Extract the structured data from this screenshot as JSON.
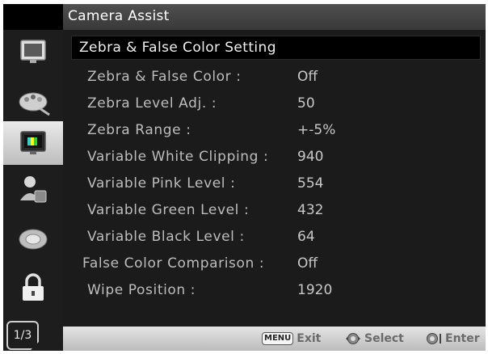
{
  "window": {
    "title": "Camera Assist"
  },
  "sidebar": {
    "items": [
      {
        "icon": "monitor-icon"
      },
      {
        "icon": "color-palette-icon"
      },
      {
        "icon": "camera-assist-monitor-icon",
        "active": true
      },
      {
        "icon": "user-settings-icon"
      },
      {
        "icon": "color-wheel-icon"
      },
      {
        "icon": "lock-icon"
      }
    ],
    "page_indicator": "1/3"
  },
  "section": {
    "title": "Zebra & False Color Setting"
  },
  "settings": [
    {
      "label": "Zebra & False Color :",
      "value": "Off"
    },
    {
      "label": "Zebra Level Adj. :",
      "value": "50"
    },
    {
      "label": "Zebra Range :",
      "value": "+-5%"
    },
    {
      "label": "Variable White Clipping :",
      "value": "940"
    },
    {
      "label": "Variable Pink Level :",
      "value": "554"
    },
    {
      "label": "Variable Green Level :",
      "value": "432"
    },
    {
      "label": "Variable Black Level :",
      "value": "64"
    },
    {
      "label": "False Color Comparison :",
      "value": "Off"
    },
    {
      "label": "Wipe Position :",
      "value": "1920"
    }
  ],
  "help": {
    "menu_key": "MENU",
    "exit_label": "Exit",
    "select_label": "Select",
    "enter_label": "Enter"
  }
}
